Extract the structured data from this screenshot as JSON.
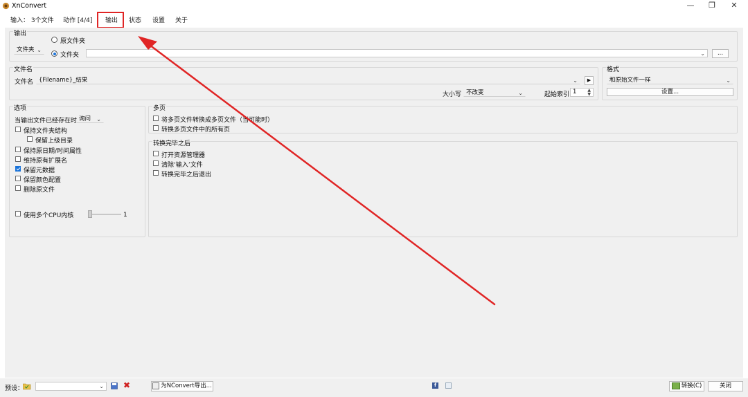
{
  "window": {
    "title": "XnConvert",
    "minimize": "—",
    "maximize": "❐",
    "close": "✕"
  },
  "tabs": [
    {
      "label": "输入： 3个文件"
    },
    {
      "label": "动作 [4/4]"
    },
    {
      "label": "输出"
    },
    {
      "label": "状态"
    },
    {
      "label": "设置"
    },
    {
      "label": "关于"
    }
  ],
  "output_group": {
    "label": "输出",
    "type_select": "文件夹",
    "radio_source": "原文件夹",
    "radio_folder": "文件夹",
    "path_value": "",
    "browse_label": "..."
  },
  "filename_group": {
    "label": "文件名",
    "field_label": "文件名",
    "value": "{Filename}_结果",
    "case_label": "大小写",
    "case_value": "不改变",
    "start_index_label": "起始索引",
    "start_index_value": "1"
  },
  "format_group": {
    "label": "格式",
    "value": "和原始文件一样",
    "settings_label": "设置..."
  },
  "options_group": {
    "label": "选项",
    "exists_label": "当输出文件已经存在时",
    "exists_value": "询问",
    "keep_folder_structure": "保持文件夹结构",
    "keep_parent_dir": "保留上级目录",
    "keep_datetime": "保持原日期/时间属性",
    "keep_extension": "维持原有扩展名",
    "keep_metadata": "保留元数据",
    "keep_color_profile": "保留颜色配置",
    "delete_original": "删除原文件",
    "multi_cpu": "使用多个CPU内核",
    "cpu_value": "1"
  },
  "multipage_group": {
    "label": "多页",
    "convert_multipage": "将多页文件转换成多页文件（当可能时）",
    "convert_all_pages": "转换多页文件中的所有页"
  },
  "after_group": {
    "label": "转换完毕之后",
    "open_explorer": "打开资源管理器",
    "clear_input": "清除‘输入’文件",
    "exit_after": "转换完毕之后退出"
  },
  "statusbar": {
    "preset_label": "预设：",
    "preset_value": "",
    "export_label": "为NConvert导出...",
    "convert_label": "转换(C)",
    "close_label": "关闭"
  },
  "colors": {
    "accent": "#1a73d9",
    "highlight_red": "#e02525",
    "panel_bg": "#f0f0f0"
  }
}
